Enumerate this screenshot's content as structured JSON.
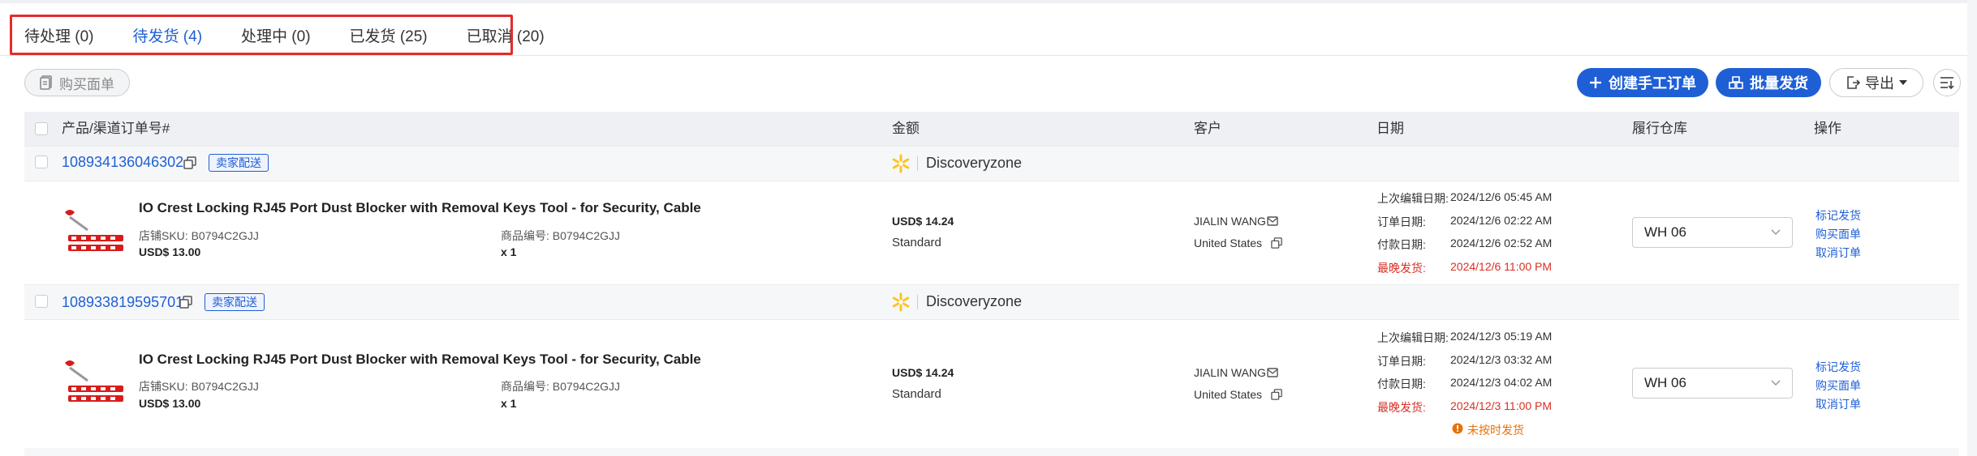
{
  "tabs": [
    {
      "label": "待处理 (0)",
      "active": false
    },
    {
      "label": "待发货 (4)",
      "active": true
    },
    {
      "label": "处理中 (0)",
      "active": false
    },
    {
      "label": "已发货 (25)",
      "active": false
    },
    {
      "label": "已取消 (20)",
      "active": false
    }
  ],
  "toolbar": {
    "buy_label": "购买面单",
    "create_label": "创建手工订单",
    "batch_label": "批量发货",
    "export_label": "导出"
  },
  "table": {
    "headers": {
      "product": "产品/渠道订单号#",
      "amount": "金额",
      "customer": "客户",
      "date": "日期",
      "warehouse": "履行仓库",
      "action": "操作"
    }
  },
  "orders": [
    {
      "order_no": "108934136046302",
      "tag": "卖家配送",
      "store": "Discoveryzone",
      "product_title": "IO Crest Locking RJ45 Port Dust Blocker with Removal Keys Tool - for Security, Cable",
      "sku": "店铺SKU: B0794C2GJJ",
      "item_no": "商品编号: B0794C2GJJ",
      "price": "USD$ 13.00",
      "qty": "x 1",
      "amount": "USD$ 14.24",
      "shipping": "Standard",
      "customer": "JIALIN WANG",
      "country": "United States",
      "dates": [
        {
          "label": "上次编辑日期:",
          "value": "2024/12/6 05:45 AM",
          "red": false
        },
        {
          "label": "订单日期:",
          "value": "2024/12/6 02:22 AM",
          "red": false
        },
        {
          "label": "付款日期:",
          "value": "2024/12/6 02:52 AM",
          "red": false
        },
        {
          "label": "最晚发货:",
          "value": "2024/12/6 11:00 PM",
          "red": true
        }
      ],
      "warning": "",
      "warehouse": "WH 06",
      "actions": [
        "标记发货",
        "购买面单",
        "取消订单"
      ]
    },
    {
      "order_no": "108933819595701",
      "tag": "卖家配送",
      "store": "Discoveryzone",
      "product_title": "IO Crest Locking RJ45 Port Dust Blocker with Removal Keys Tool - for Security, Cable",
      "sku": "店铺SKU: B0794C2GJJ",
      "item_no": "商品编号: B0794C2GJJ",
      "price": "USD$ 13.00",
      "qty": "x 1",
      "amount": "USD$ 14.24",
      "shipping": "Standard",
      "customer": "JIALIN WANG",
      "country": "United States",
      "dates": [
        {
          "label": "上次编辑日期:",
          "value": "2024/12/3 05:19 AM",
          "red": false
        },
        {
          "label": "订单日期:",
          "value": "2024/12/3 03:32 AM",
          "red": false
        },
        {
          "label": "付款日期:",
          "value": "2024/12/3 04:02 AM",
          "red": false
        },
        {
          "label": "最晚发货:",
          "value": "2024/12/3 11:00 PM",
          "red": true
        }
      ],
      "warning": "未按时发货",
      "warehouse": "WH 06",
      "actions": [
        "标记发货",
        "购买面单",
        "取消订单"
      ]
    }
  ],
  "colors": {
    "primary": "#1f5fd6",
    "danger": "#d93025",
    "warning": "#e8710a",
    "walmart": "#ffc220"
  }
}
